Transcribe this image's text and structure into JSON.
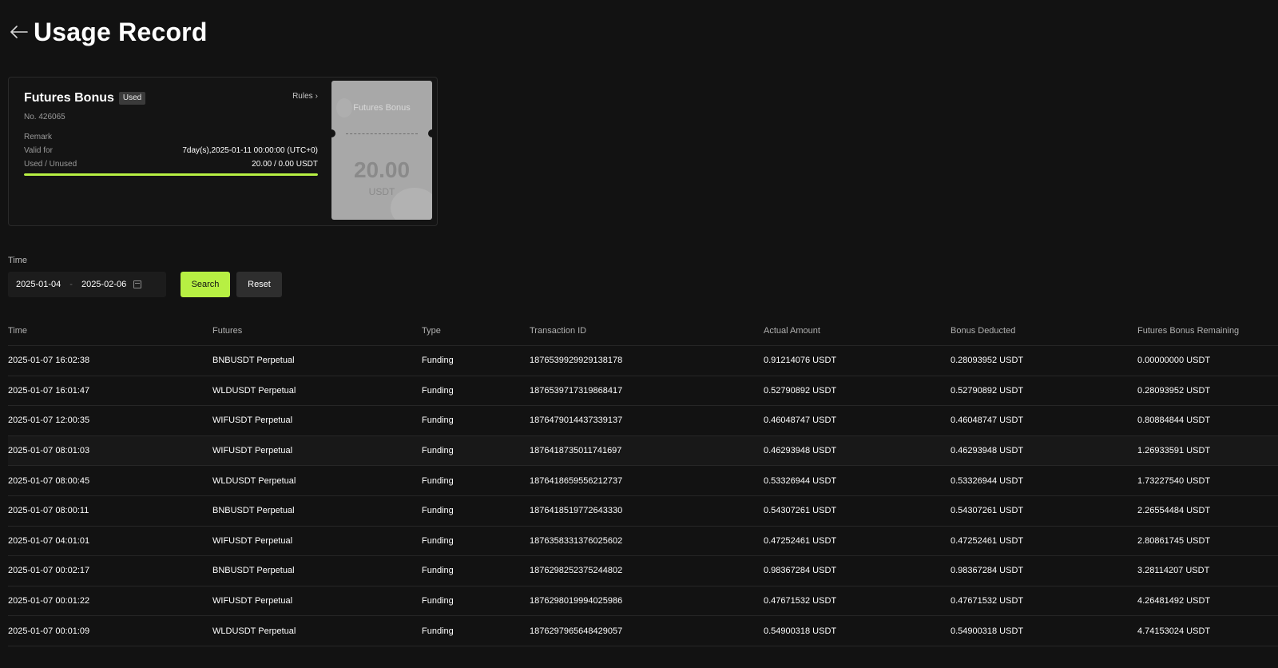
{
  "header": {
    "title": "Usage Record"
  },
  "bonus": {
    "title": "Futures Bonus",
    "status": "Used",
    "rules_label": "Rules",
    "number": "No. 426065",
    "remark_label": "Remark",
    "valid_label": "Valid for",
    "valid_value": "7day(s),2025-01-11 00:00:00 (UTC+0)",
    "used_label": "Used / Unused",
    "used_value": "20.00 / 0.00 USDT",
    "progress_fraction": 1.0,
    "coupon_label": "Futures Bonus",
    "coupon_amount": "20.00",
    "coupon_unit": "USDT",
    "accent_color": "#b7f043"
  },
  "filters": {
    "time_label": "Time",
    "start_date": "2025-01-04",
    "separator": "-",
    "end_date": "2025-02-06",
    "search_label": "Search",
    "reset_label": "Reset"
  },
  "table": {
    "columns": [
      "Time",
      "Futures",
      "Type",
      "Transaction ID",
      "Actual Amount",
      "Bonus Deducted",
      "Futures Bonus Remaining"
    ],
    "rows": [
      [
        "2025-01-07 16:02:38",
        "BNBUSDT Perpetual",
        "Funding",
        "1876539929929138178",
        "0.91214076 USDT",
        "0.28093952 USDT",
        "0.00000000 USDT"
      ],
      [
        "2025-01-07 16:01:47",
        "WLDUSDT Perpetual",
        "Funding",
        "1876539717319868417",
        "0.52790892 USDT",
        "0.52790892 USDT",
        "0.28093952 USDT"
      ],
      [
        "2025-01-07 12:00:35",
        "WIFUSDT Perpetual",
        "Funding",
        "1876479014437339137",
        "0.46048747 USDT",
        "0.46048747 USDT",
        "0.80884844 USDT"
      ],
      [
        "2025-01-07 08:01:03",
        "WIFUSDT Perpetual",
        "Funding",
        "1876418735011741697",
        "0.46293948 USDT",
        "0.46293948 USDT",
        "1.26933591 USDT"
      ],
      [
        "2025-01-07 08:00:45",
        "WLDUSDT Perpetual",
        "Funding",
        "1876418659556212737",
        "0.53326944 USDT",
        "0.53326944 USDT",
        "1.73227540 USDT"
      ],
      [
        "2025-01-07 08:00:11",
        "BNBUSDT Perpetual",
        "Funding",
        "1876418519772643330",
        "0.54307261 USDT",
        "0.54307261 USDT",
        "2.26554484 USDT"
      ],
      [
        "2025-01-07 04:01:01",
        "WIFUSDT Perpetual",
        "Funding",
        "1876358331376025602",
        "0.47252461 USDT",
        "0.47252461 USDT",
        "2.80861745 USDT"
      ],
      [
        "2025-01-07 00:02:17",
        "BNBUSDT Perpetual",
        "Funding",
        "1876298252375244802",
        "0.98367284 USDT",
        "0.98367284 USDT",
        "3.28114207 USDT"
      ],
      [
        "2025-01-07 00:01:22",
        "WIFUSDT Perpetual",
        "Funding",
        "1876298019994025986",
        "0.47671532 USDT",
        "0.47671532 USDT",
        "4.26481492 USDT"
      ],
      [
        "2025-01-07 00:01:09",
        "WLDUSDT Perpetual",
        "Funding",
        "1876297965648429057",
        "0.54900318 USDT",
        "0.54900318 USDT",
        "4.74153024 USDT"
      ]
    ],
    "highlighted_row": 3
  }
}
